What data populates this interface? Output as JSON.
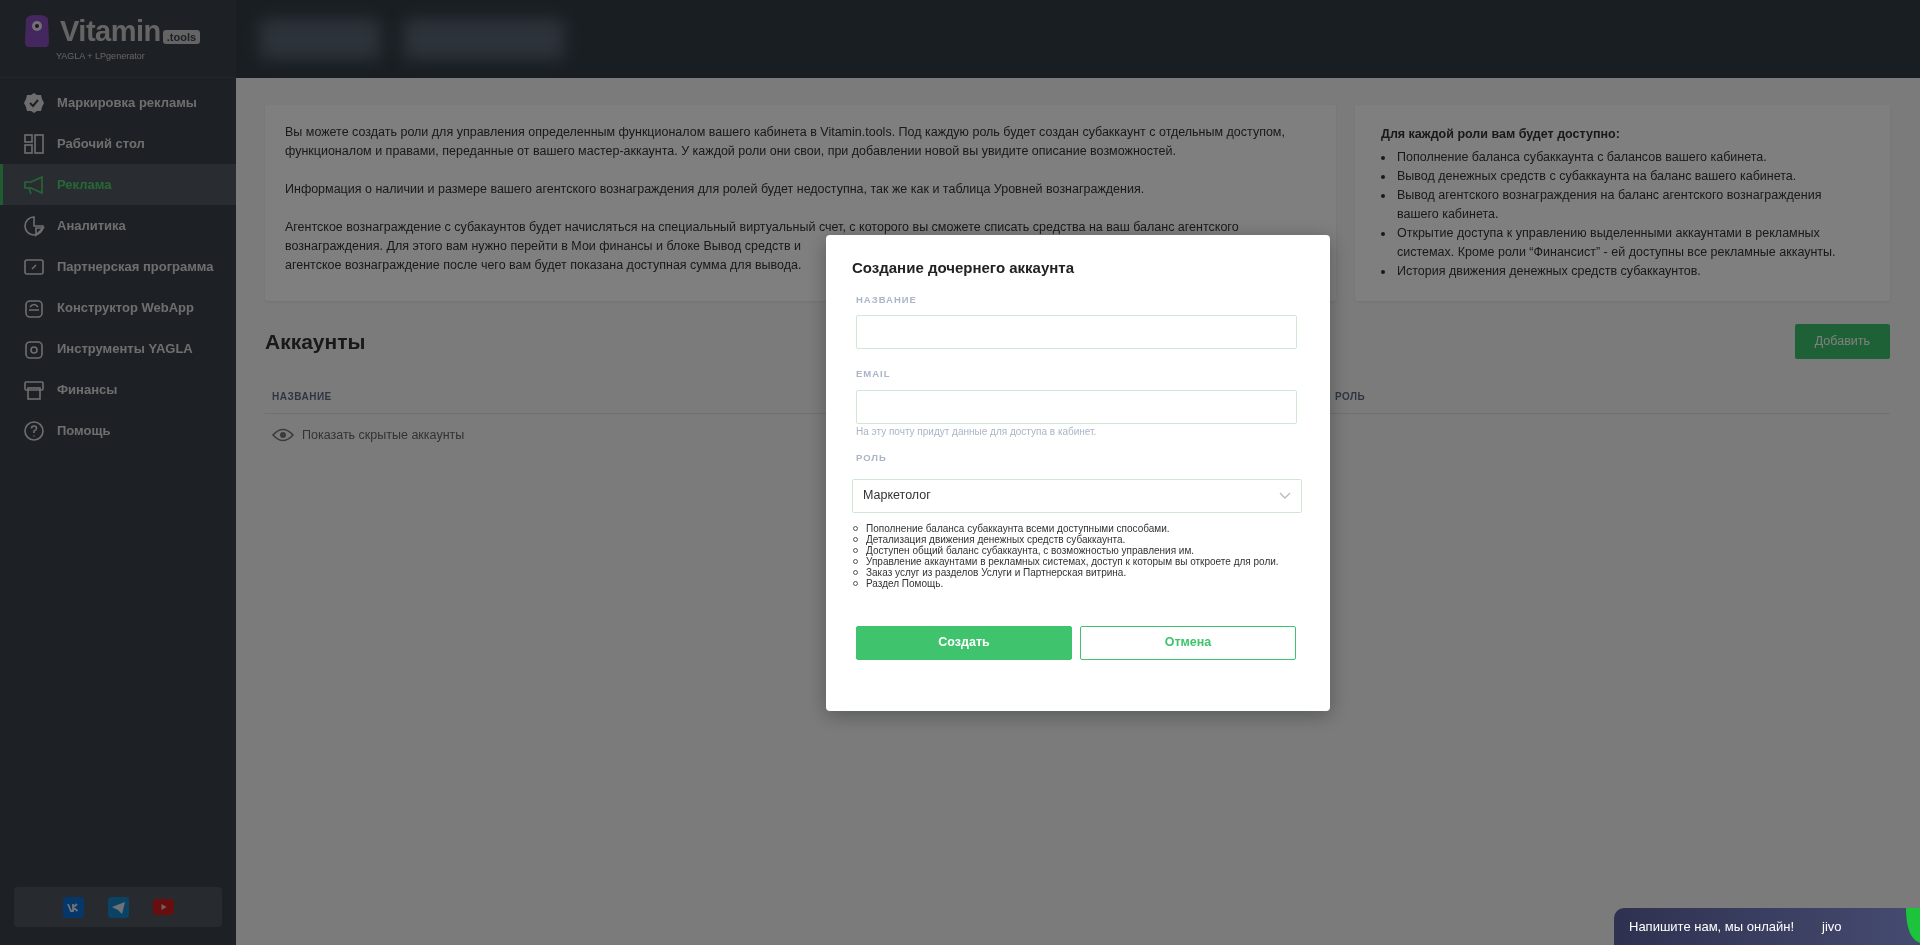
{
  "brand": {
    "name": "Vitamin",
    "badge": ".tools",
    "tagline": "YAGLA + LPgenerator"
  },
  "sidebar": {
    "items": [
      {
        "label": "Маркировка рекламы",
        "selected": false
      },
      {
        "label": "Рабочий стол",
        "selected": false
      },
      {
        "label": "Реклама",
        "selected": true
      },
      {
        "label": "Аналитика",
        "selected": false
      },
      {
        "label": "Партнерская программа",
        "selected": false
      },
      {
        "label": "Конструктор WebApp",
        "selected": false
      },
      {
        "label": "Инструменты YAGLA",
        "selected": false
      },
      {
        "label": "Финансы",
        "selected": false
      },
      {
        "label": "Помощь",
        "selected": false
      }
    ]
  },
  "info_card": {
    "paragraphs": [
      "Вы можете создать роли для управления определенным функционалом вашего кабинета в Vitamin.tools. Под каждую роль будет создан субаккаунт с отдельным доступом, функционалом и правами, переданные от вашего мастер-аккаунта. У каждой роли они свои, при добавлении новой вы увидите описание возможностей.",
      "Информация о наличии и размере вашего агентского вознаграждения для ролей будет недоступна, так же как и таблица Уровней вознаграждения.",
      "Агентское вознаграждение с субакаунтов будет начисляться на специальный виртуальный счет, с которого вы сможете списать средства на ваш баланс агентского вознаграждения. Для этого вам нужно перейти в Мои финансы и блоке Вывод средств и",
      "агентское вознаграждение после чего вам будет показана доступная сумма для вывода."
    ]
  },
  "roles_card": {
    "title": "Для каждой роли вам будет доступно:",
    "items": [
      "Пополнение баланса субаккаунта с балансов вашего кабинета.",
      "Вывод денежных средств с субаккаунта на баланс вашего кабинета.",
      "Вывод агентского вознаграждения на баланс агентского вознаграждения вашего кабинета.",
      "Открытие доступа к управлению выделенными аккаунтами в рекламных системах. Кроме роли “Финансист” - ей доступны все рекламные аккаунты.",
      "История движения денежных средств субаккаунтов."
    ]
  },
  "accounts": {
    "title": "Аккаунты",
    "add_button": "Добавить",
    "columns": [
      "НАЗВАНИЕ",
      "РОЛЬ"
    ],
    "show_hidden": "Показать скрытые аккаунты"
  },
  "modal": {
    "title": "Создание дочернего аккаунта",
    "name_label": "НАЗВАНИЕ",
    "email_label": "EMAIL",
    "email_hint": "На эту почту придут данные для доступа в кабинет.",
    "role_label": "РОЛЬ",
    "role_value": "Маркетолог",
    "role_features": [
      "Пополнение баланса субаккаунта всеми доступными способами.",
      "Детализация движения денежных средств субаккаунта.",
      "Доступен общий баланс субаккаунта, с возможностью управления им.",
      "Управление аккаунтами в рекламных системах, доступ к которым вы откроете для роли.",
      "Заказ услуг из разделов Услуги и Партнерская витрина.",
      "Раздел Помощь."
    ],
    "create_button": "Создать",
    "cancel_button": "Отмена"
  },
  "chat": {
    "text": "Напишите нам, мы онлайн!",
    "brand": "jivo"
  }
}
